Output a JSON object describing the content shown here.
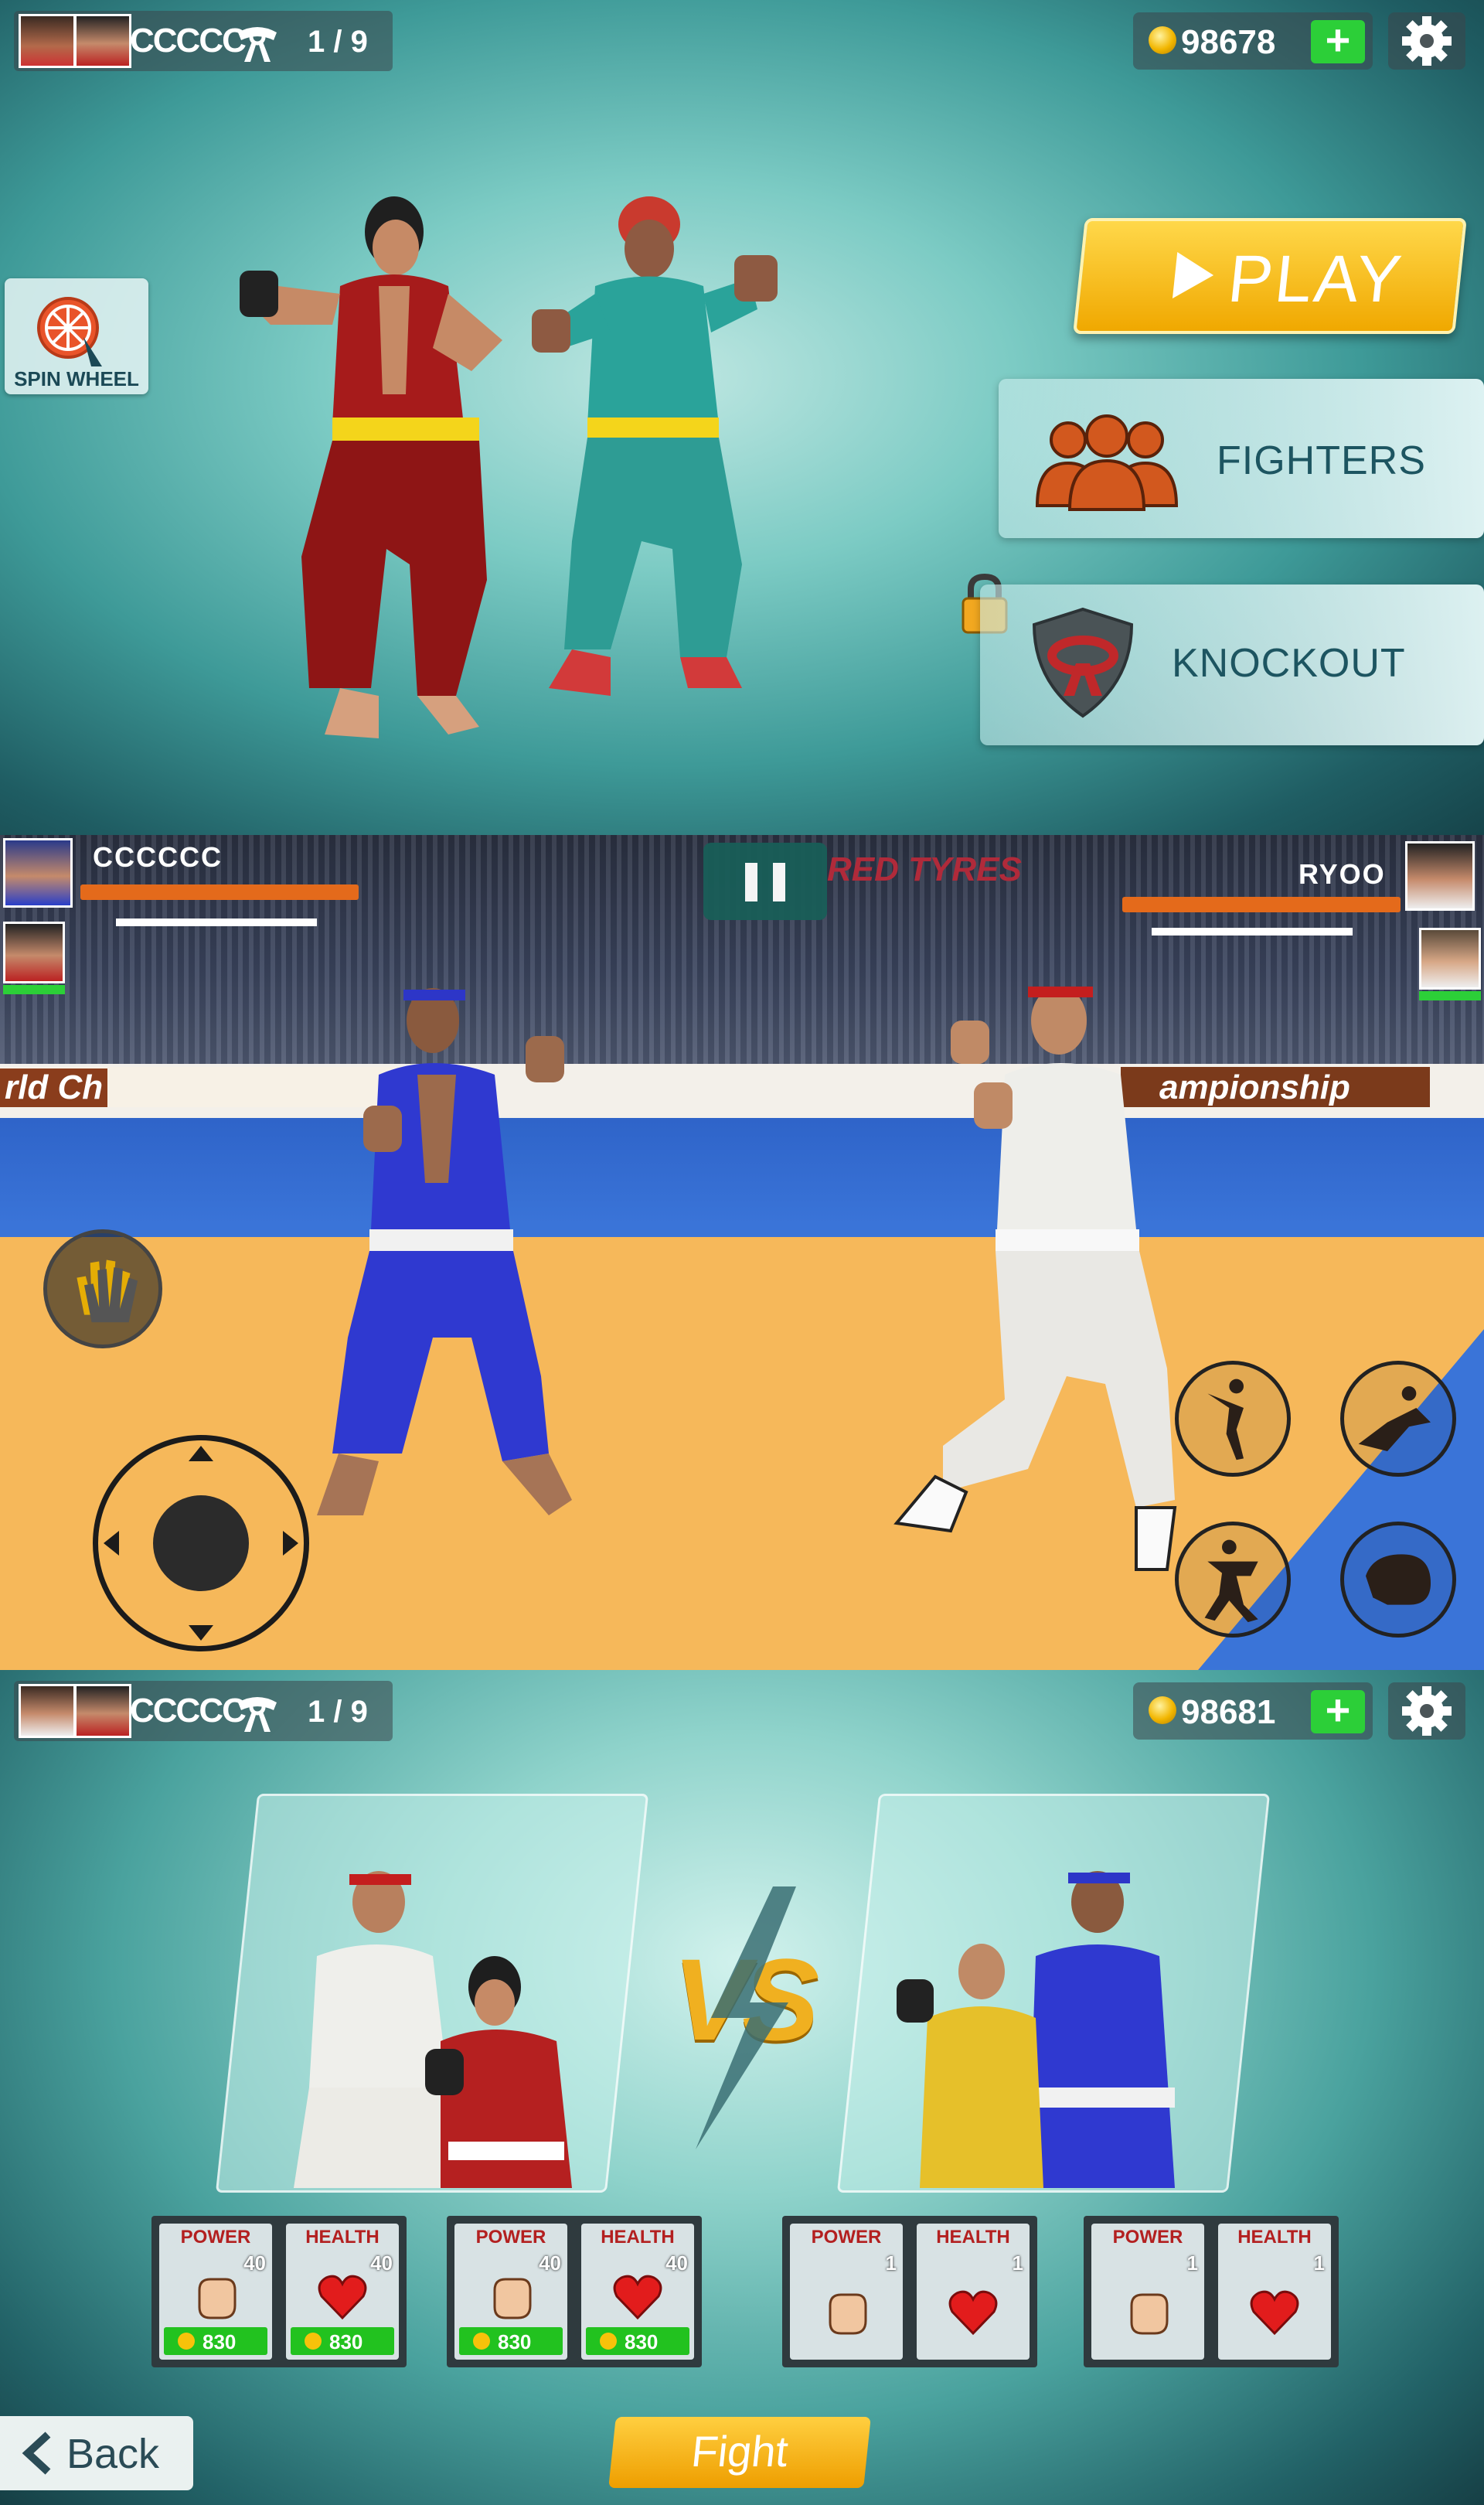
{
  "menu_screen": {
    "player_name": "CCCCC",
    "stage_progress": "1 / 9",
    "coins": "98678",
    "plus_label": "+",
    "spin_wheel_label": "SPIN WHEEL",
    "play_label": "PLAY",
    "fighters_label": "FIGHTERS",
    "knockout_label": "KNOCKOUT",
    "colors": {
      "play": "#f0a800",
      "fighters_icon": "#d2581e",
      "knockout_icon": "#c0282a"
    }
  },
  "fight_screen": {
    "player_name": "CCCCCC",
    "opponent_name": "RYOO",
    "banner_left": "rld Ch",
    "banner_sponsor": "RED TYRES",
    "banner_right": "ampionship",
    "colors": {
      "health": "#e46a1b",
      "energy": "#2ccf38",
      "mat_orange": "#f6b85a",
      "mat_blue": "#3a74d8"
    }
  },
  "vs_screen": {
    "player_name": "CCCCC",
    "stage_progress": "1 / 9",
    "coins": "98681",
    "plus_label": "+",
    "vs_label": "VS",
    "stat_groups": [
      {
        "stats": [
          {
            "title": "POWER",
            "level": "40",
            "cost": "830",
            "icon": "fist-icon"
          },
          {
            "title": "HEALTH",
            "level": "40",
            "cost": "830",
            "icon": "heart-icon"
          }
        ]
      },
      {
        "stats": [
          {
            "title": "POWER",
            "level": "40",
            "cost": "830",
            "icon": "fist-icon"
          },
          {
            "title": "HEALTH",
            "level": "40",
            "cost": "830",
            "icon": "heart-icon"
          }
        ]
      },
      {
        "stats": [
          {
            "title": "POWER",
            "level": "1",
            "icon": "fist-icon"
          },
          {
            "title": "HEALTH",
            "level": "1",
            "icon": "heart-icon"
          }
        ]
      },
      {
        "stats": [
          {
            "title": "POWER",
            "level": "1",
            "icon": "fist-icon"
          },
          {
            "title": "HEALTH",
            "level": "1",
            "icon": "heart-icon"
          }
        ]
      }
    ],
    "back_label": "Back",
    "fight_label": "Fight"
  }
}
